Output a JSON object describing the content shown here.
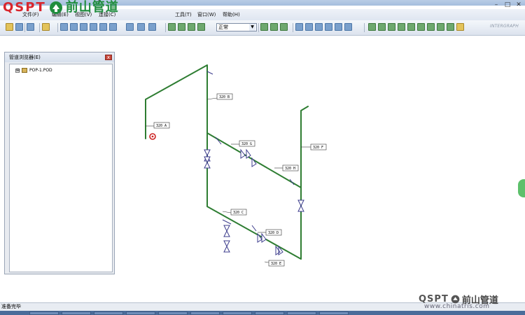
{
  "window": {
    "title": "P"
  },
  "menu": {
    "items": [
      {
        "label": "文件(F)"
      },
      {
        "label": "编辑(E)"
      },
      {
        "label": "视图(V)"
      },
      {
        "label": "连接(C)"
      },
      {
        "label": "工具(T)"
      },
      {
        "label": "窗口(W)"
      },
      {
        "label": "帮助(H)"
      }
    ]
  },
  "toolbar": {
    "view_mode": "正常",
    "brand": "INTERGRAPH"
  },
  "browser": {
    "title": "管道浏览器(E)",
    "tree": [
      {
        "label": "POP-1.POD",
        "expander": "⊞"
      }
    ]
  },
  "drawing": {
    "tags": [
      "320 B",
      "320 A",
      "320 F",
      "320 G",
      "320 H",
      "320 C",
      "320 D",
      "320 E"
    ]
  },
  "status": {
    "text": "准备完毕"
  },
  "watermark": {
    "brand": "QSPT",
    "cn_name": "前山管道",
    "url": "www.chinatris.com"
  },
  "colors": {
    "pipe": "#2e7d32",
    "valve": "#3c3c8c",
    "tag_border": "#333333",
    "marker": "#cc2222",
    "brand_red": "#d9262d",
    "brand_green": "#1f8d3d"
  }
}
